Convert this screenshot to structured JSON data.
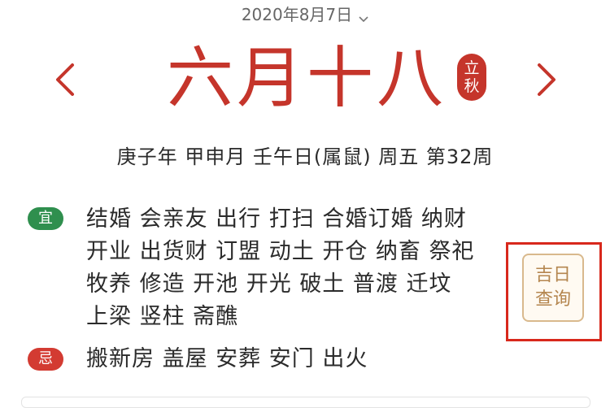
{
  "header": {
    "date": "2020年8月7日",
    "chevron_icon": "chevron-down-icon"
  },
  "nav": {
    "prev_icon": "chevron-left-icon",
    "next_icon": "chevron-right-icon",
    "arrow_color": "#c5352b"
  },
  "lunar": {
    "date": "六月十八",
    "solar_term_line1": "立",
    "solar_term_line2": "秋",
    "color": "#c5352b"
  },
  "ganzhi": {
    "text": "庚子年 甲申月 壬午日(属鼠) 周五 第32周"
  },
  "yi": {
    "badge": "宜",
    "color": "#2f8f4e",
    "lines": [
      "结婚 会亲友 出行 打扫 合婚订婚 纳财",
      "开业 出货财 订盟 动土 开仓 纳畜 祭祀",
      "牧养 修造 开池 开光 破土 普渡 迁坟",
      "上梁 竖柱 斋醮"
    ]
  },
  "ji": {
    "badge": "忌",
    "color": "#d33b32",
    "text": "搬新房 盖屋 安葬 安门 出火"
  },
  "lucky_day_button": {
    "line1": "吉日",
    "line2": "查询",
    "color": "#b4864f"
  }
}
